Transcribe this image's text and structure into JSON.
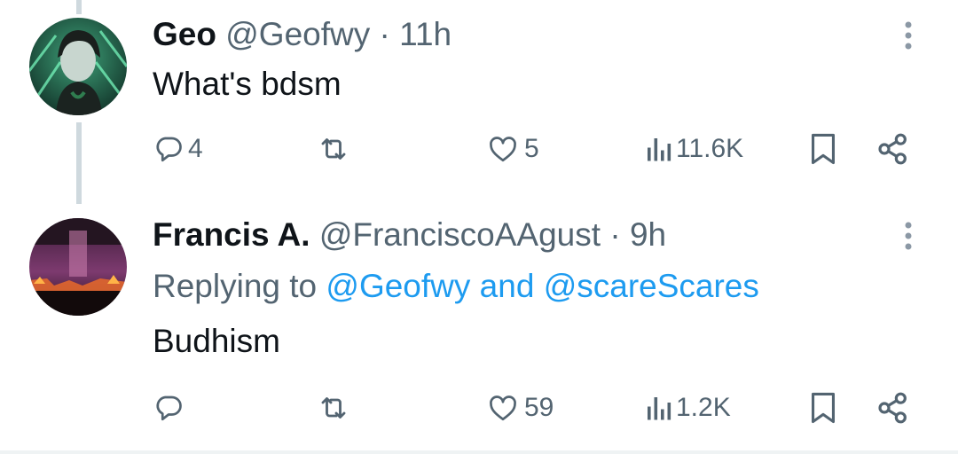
{
  "tweets": [
    {
      "display_name": "Geo",
      "handle": "@Geofwy",
      "separator": "·",
      "time": "11h",
      "text": "What's bdsm",
      "actions": {
        "replies": "4",
        "retweets": "",
        "likes": "5",
        "views": "11.6K"
      },
      "avatar_icon": "avatar-anime-character"
    },
    {
      "display_name": "Francis A.",
      "handle": "@FranciscoAAgust",
      "separator": "·",
      "time": "9h",
      "replying_prefix": "Replying to",
      "replying_mention_1": "@Geofwy",
      "replying_and": "and",
      "replying_mention_2": "@scareScares",
      "text": "Budhism",
      "actions": {
        "replies": "",
        "retweets": "",
        "likes": "59",
        "views": "1.2K"
      },
      "avatar_icon": "avatar-dark-stage-photo"
    }
  ],
  "icons": {
    "reply": "reply-icon",
    "retweet": "retweet-icon",
    "like": "heart-icon",
    "views": "views-icon",
    "bookmark": "bookmark-icon",
    "share": "share-icon",
    "more": "more-icon"
  },
  "colors": {
    "text_primary": "#0f1419",
    "text_secondary": "#536471",
    "link": "#1d9bf0",
    "thread_line": "#cfd9de"
  }
}
